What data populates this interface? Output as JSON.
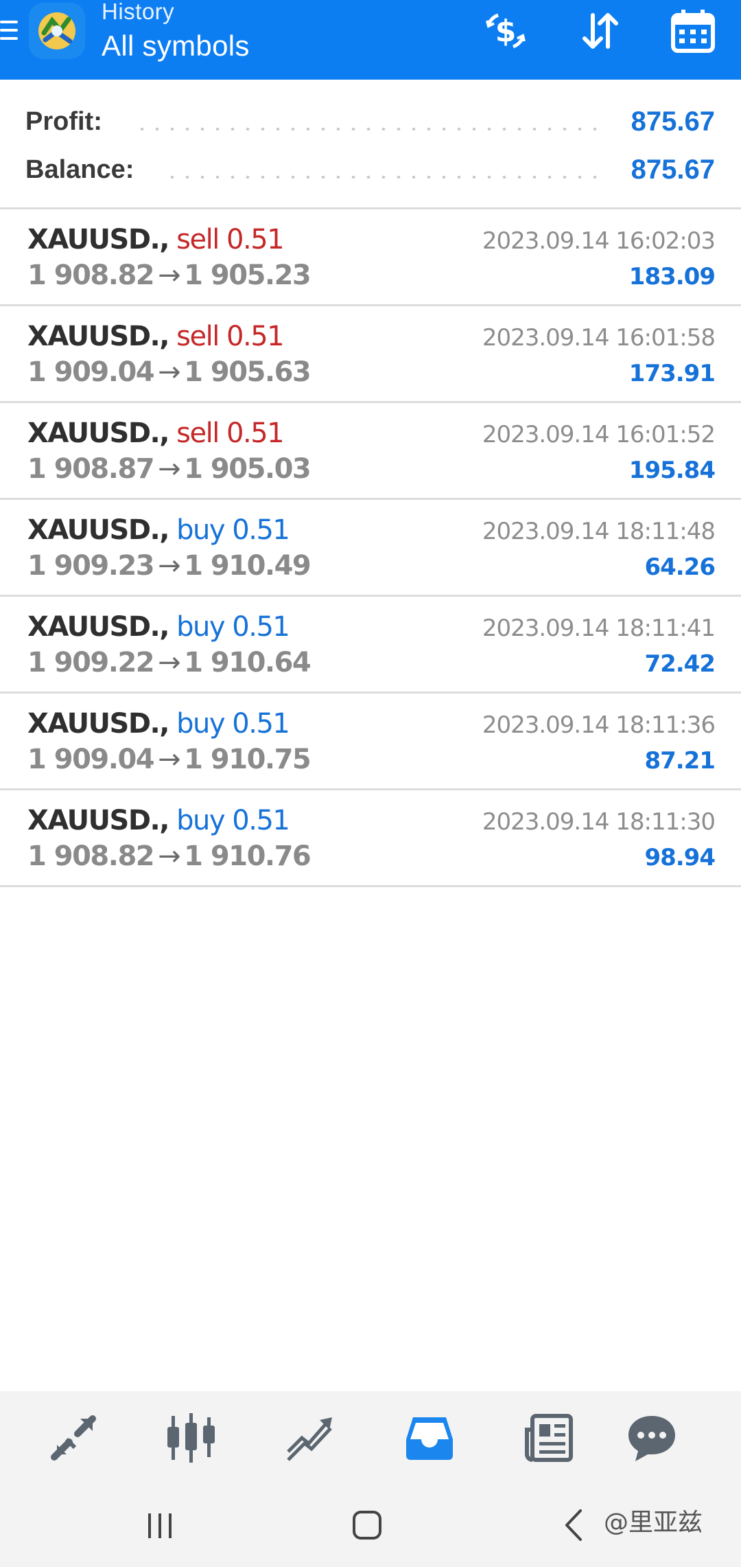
{
  "header": {
    "title": "History",
    "subtitle": "All symbols",
    "icons": [
      "menu-icon",
      "deposit-dollar-icon",
      "sort-icon",
      "calendar-icon"
    ]
  },
  "summary": {
    "profit_label": "Profit:",
    "profit_value": "875.67",
    "balance_label": "Balance:",
    "balance_value": "875.67"
  },
  "deals": [
    {
      "symbol": "XAUUSD.,",
      "side": "sell 0.51",
      "type": "sell",
      "open": "1 908.82",
      "close": "1 905.23",
      "time": "2023.09.14 16:02:03",
      "profit": "183.09"
    },
    {
      "symbol": "XAUUSD.,",
      "side": "sell 0.51",
      "type": "sell",
      "open": "1 909.04",
      "close": "1 905.63",
      "time": "2023.09.14 16:01:58",
      "profit": "173.91"
    },
    {
      "symbol": "XAUUSD.,",
      "side": "sell 0.51",
      "type": "sell",
      "open": "1 908.87",
      "close": "1 905.03",
      "time": "2023.09.14 16:01:52",
      "profit": "195.84"
    },
    {
      "symbol": "XAUUSD.,",
      "side": "buy 0.51",
      "type": "buy",
      "open": "1 909.23",
      "close": "1 910.49",
      "time": "2023.09.14 18:11:48",
      "profit": "64.26"
    },
    {
      "symbol": "XAUUSD.,",
      "side": "buy 0.51",
      "type": "buy",
      "open": "1 909.22",
      "close": "1 910.64",
      "time": "2023.09.14 18:11:41",
      "profit": "72.42"
    },
    {
      "symbol": "XAUUSD.,",
      "side": "buy 0.51",
      "type": "buy",
      "open": "1 909.04",
      "close": "1 910.75",
      "time": "2023.09.14 18:11:36",
      "profit": "87.21"
    },
    {
      "symbol": "XAUUSD.,",
      "side": "buy 0.51",
      "type": "buy",
      "open": "1 908.82",
      "close": "1 910.76",
      "time": "2023.09.14 18:11:30",
      "profit": "98.94"
    }
  ],
  "arrow": "→",
  "bottom_nav": {
    "items": [
      "quotes-icon",
      "charts-icon",
      "trade-icon",
      "history-icon",
      "news-icon",
      "chat-icon"
    ],
    "active": "history-icon"
  },
  "system_nav": {
    "icons": [
      "recents-icon",
      "home-icon",
      "back-icon"
    ],
    "watermark": "@里亚兹"
  },
  "colors": {
    "accent": "#0d7ef2",
    "sell": "#c62828",
    "buy": "#1672d8",
    "profit": "#1672d8"
  }
}
